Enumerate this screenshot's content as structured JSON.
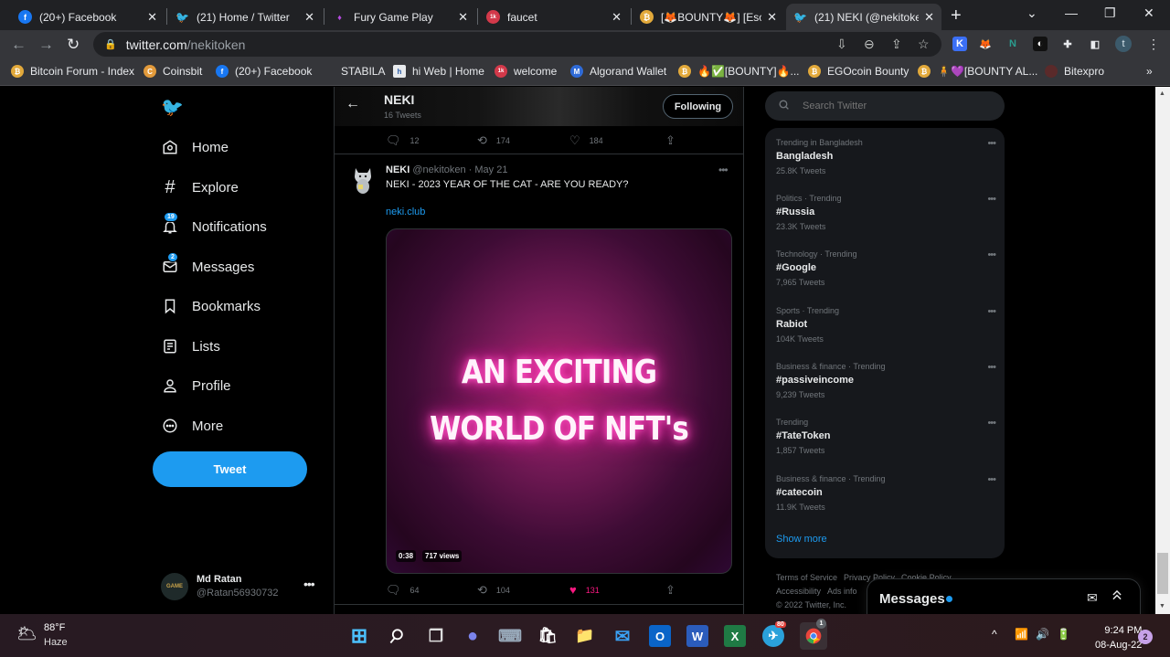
{
  "browser": {
    "tabs": [
      {
        "title": "(20+) Facebook",
        "icon": "facebook-icon",
        "color": "#1877f2",
        "glyph": "f"
      },
      {
        "title": "(21) Home / Twitter",
        "icon": "twitter-icon",
        "color": "#1d9bf0",
        "glyph": "🐦"
      },
      {
        "title": "Fury Game Play",
        "icon": "fury-game-icon",
        "color": "#8a3fd1",
        "glyph": "♦"
      },
      {
        "title": "faucet",
        "icon": "faucet-icon",
        "color": "#d3394a",
        "glyph": "1k"
      },
      {
        "title": "[🦊BOUNTY🦊] [Escr",
        "icon": "bitcoin-icon",
        "color": "#e2a93b",
        "glyph": "₿"
      },
      {
        "title": "(21) NEKI (@nekitoken",
        "icon": "twitter-icon",
        "color": "#1d9bf0",
        "glyph": "🐦",
        "active": true
      }
    ],
    "close_glyph": "✕",
    "new_tab_glyph": "+",
    "window_controls": {
      "dropdown": "⌄",
      "minimize": "—",
      "restore": "❐",
      "close": "✕"
    },
    "nav": {
      "back": "←",
      "forward": "→",
      "reload": "↻"
    },
    "url": {
      "host": "twitter.com",
      "path": "/nekitoken"
    },
    "toolbar_icons": {
      "install": "⇩",
      "zoom": "⊖",
      "share": "⇪",
      "star": "☆"
    },
    "extensions": [
      {
        "name": "keplr-extension-icon",
        "glyph": "K",
        "bg": "#3b6ff5",
        "fg": "#fff"
      },
      {
        "name": "metamask-extension-icon",
        "glyph": "🦊",
        "bg": "transparent",
        "fg": "#e2761b"
      },
      {
        "name": "near-extension-icon",
        "glyph": "N",
        "bg": "transparent",
        "fg": "#2a9d8f"
      },
      {
        "name": "mask-extension-icon",
        "glyph": "◐",
        "bg": "#111",
        "fg": "#fff"
      },
      {
        "name": "puzzle-extensions-icon",
        "glyph": "✚",
        "bg": "transparent",
        "fg": "#e8eaed"
      },
      {
        "name": "sidepanel-icon",
        "glyph": "◧",
        "bg": "transparent",
        "fg": "#e8eaed"
      }
    ],
    "profile_initial": "t",
    "menu_glyph": "⋮",
    "bookmarks": [
      {
        "label": "Bitcoin Forum - Index",
        "color": "#e2a93b",
        "glyph": "₿"
      },
      {
        "label": "Coinsbit",
        "color": "#e29a3b",
        "glyph": "C"
      },
      {
        "label": "(20+) Facebook",
        "color": "#1877f2",
        "glyph": "f"
      },
      {
        "label": "STABILA",
        "color": "transparent",
        "glyph": ""
      },
      {
        "label": "hi Web | Home",
        "color": "#2c5da8",
        "glyph": "h"
      },
      {
        "label": "welcome",
        "color": "#d3394a",
        "glyph": "1k"
      },
      {
        "label": "Algorand Wallet",
        "color": "#2f6bd8",
        "glyph": "M"
      },
      {
        "label": "🔥✅[BOUNTY]🔥...",
        "color": "#e2a93b",
        "glyph": "₿"
      },
      {
        "label": "EGOcoin Bounty",
        "color": "#e2a93b",
        "glyph": "₿"
      },
      {
        "label": "🧍💜[BOUNTY AL...",
        "color": "#e2a93b",
        "glyph": "₿"
      },
      {
        "label": "Bitexpro",
        "color": "#5a2a2a",
        "glyph": ""
      }
    ],
    "bookmarks_overflow": "»"
  },
  "sidebar": {
    "logo": "🐦",
    "items": [
      {
        "label": "Home",
        "icon": "home-icon",
        "glyph": "⌂"
      },
      {
        "label": "Explore",
        "icon": "hashtag-icon",
        "glyph": "#"
      },
      {
        "label": "Notifications",
        "icon": "bell-icon",
        "glyph": "🔔",
        "badge": "19"
      },
      {
        "label": "Messages",
        "icon": "envelope-icon",
        "glyph": "✉",
        "badge": "2"
      },
      {
        "label": "Bookmarks",
        "icon": "bookmark-icon",
        "glyph": "🔖"
      },
      {
        "label": "Lists",
        "icon": "list-icon",
        "glyph": "☰"
      },
      {
        "label": "Profile",
        "icon": "person-icon",
        "glyph": "👤"
      },
      {
        "label": "More",
        "icon": "more-circle-icon",
        "glyph": "⋯"
      }
    ],
    "tweet_button": "Tweet",
    "account": {
      "name": "Md Ratan",
      "handle": "@Ratan56930732",
      "avatar_text": "GAME",
      "more": "•••"
    }
  },
  "profile_header": {
    "back": "←",
    "name": "NEKI",
    "tweet_count": "16 Tweets",
    "follow_label": "Following"
  },
  "tweets": [
    {
      "replies": "12",
      "retweets": "174",
      "likes": "184"
    },
    {
      "author": "NEKI",
      "handle": "@nekitoken",
      "date": "· May 21",
      "text": "NEKI - 2023 YEAR OF THE CAT - ARE YOU READY?",
      "link": "neki.club",
      "media": {
        "line1": "AN EXCITING",
        "line2": "WORLD OF NFT's",
        "duration": "0:38",
        "views": "717 views"
      },
      "replies": "64",
      "retweets": "104",
      "likes": "131",
      "liked": true
    }
  ],
  "search": {
    "placeholder": "Search Twitter"
  },
  "trends": [
    {
      "context": "Trending in Bangladesh",
      "name": "Bangladesh",
      "count": "25.8K Tweets"
    },
    {
      "context": "Politics · Trending",
      "name": "#Russia",
      "count": "23.3K Tweets"
    },
    {
      "context": "Technology · Trending",
      "name": "#Google",
      "count": "7,965 Tweets"
    },
    {
      "context": "Sports · Trending",
      "name": "Rabiot",
      "count": "104K Tweets"
    },
    {
      "context": "Business & finance · Trending",
      "name": "#passiveincome",
      "count": "9,239 Tweets"
    },
    {
      "context": "Trending",
      "name": "#TateToken",
      "count": "1,857 Tweets"
    },
    {
      "context": "Business & finance · Trending",
      "name": "#catecoin",
      "count": "11.9K Tweets"
    }
  ],
  "show_more": "Show more",
  "footer": {
    "links": [
      "Terms of Service",
      "Privacy Policy",
      "Cookie Policy",
      "Accessibility",
      "Ads info"
    ],
    "copyright": "© 2022 Twitter, Inc."
  },
  "messages_dock": {
    "title": "Messages",
    "compose": "✉",
    "collapse": "⌃"
  },
  "taskbar": {
    "weather": {
      "temp": "88°F",
      "condition": "Haze"
    },
    "apps": [
      {
        "name": "start-button",
        "glyph": "⊞",
        "bg": "transparent",
        "fg": "#4cc2ff"
      },
      {
        "name": "search-button",
        "glyph": "⚲",
        "bg": "transparent",
        "fg": "#fff"
      },
      {
        "name": "task-view-button",
        "glyph": "❐",
        "bg": "transparent",
        "fg": "#ddd"
      },
      {
        "name": "teams-chat-button",
        "glyph": "●",
        "bg": "transparent",
        "fg": "#7b83eb"
      },
      {
        "name": "keyboard-button",
        "glyph": "⌨",
        "bg": "transparent",
        "fg": "#9ab"
      },
      {
        "name": "store-button",
        "glyph": "🛍",
        "bg": "transparent",
        "fg": "#fff"
      },
      {
        "name": "file-explorer-button",
        "glyph": "📁",
        "bg": "transparent",
        "fg": "#f4c542"
      },
      {
        "name": "mail-button",
        "glyph": "✉",
        "bg": "transparent",
        "fg": "#3aa0f3"
      },
      {
        "name": "outlook-button",
        "glyph": "O",
        "bg": "#0a64c8",
        "fg": "#fff"
      },
      {
        "name": "word-button",
        "glyph": "W",
        "bg": "#2b5cbb",
        "fg": "#fff"
      },
      {
        "name": "excel-button",
        "glyph": "X",
        "bg": "#1f7a44",
        "fg": "#fff"
      },
      {
        "name": "telegram-button",
        "glyph": "✈",
        "bg": "#2aa1da",
        "fg": "#fff",
        "badge": "80"
      },
      {
        "name": "chrome-button",
        "glyph": "◉",
        "bg": "transparent",
        "fg": "#e8453c",
        "badge": "1"
      }
    ],
    "tray": {
      "chevron": "^",
      "wifi": "📶",
      "volume": "🔊",
      "battery": "🔋"
    },
    "time": "9:24 PM",
    "date": "08-Aug-22",
    "notifications": "2"
  }
}
